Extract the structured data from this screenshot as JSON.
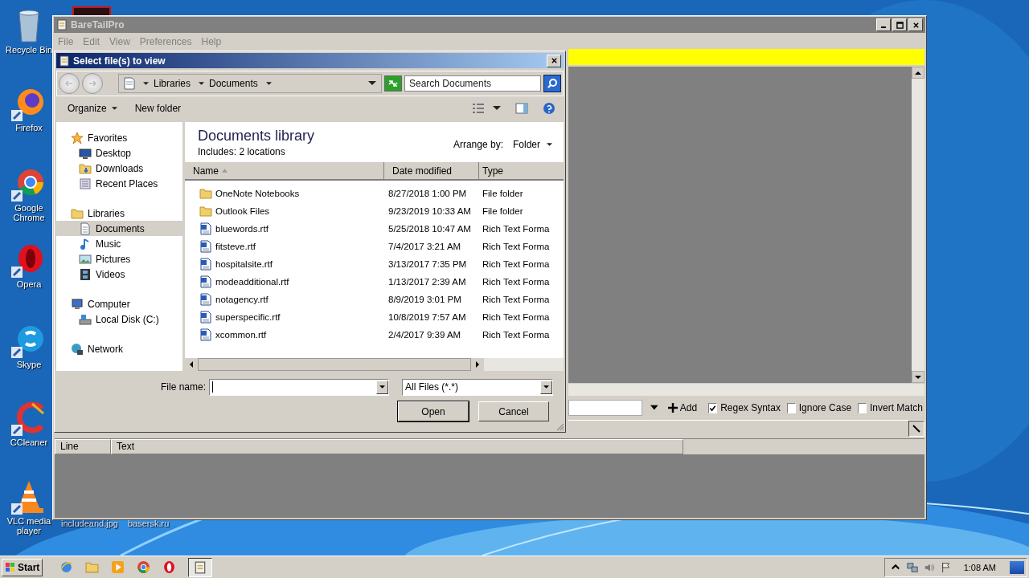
{
  "desktop": {
    "icons": [
      {
        "label": "Recycle Bin"
      },
      {
        "label": "Firefox"
      },
      {
        "label": "Google Chrome"
      },
      {
        "label": "Opera"
      },
      {
        "label": "Skype"
      },
      {
        "label": "CCleaner"
      },
      {
        "label": "VLC media player"
      }
    ],
    "files": [
      {
        "label": "includeand.jpg"
      },
      {
        "label": "basersk.ru"
      }
    ]
  },
  "main_window": {
    "title": "BareTailPro",
    "menu": [
      "File",
      "Edit",
      "View",
      "Preferences",
      "Help"
    ],
    "filter": {
      "add": "Add",
      "options": [
        {
          "label": "Regex Syntax",
          "checked": true
        },
        {
          "label": "Ignore Case",
          "checked": false
        },
        {
          "label": "Invert Match",
          "checked": false
        }
      ]
    },
    "columns": [
      "Line",
      "Text"
    ]
  },
  "dialog": {
    "title": "Select file(s) to view",
    "breadcrumb": [
      "Libraries",
      "Documents"
    ],
    "search": {
      "placeholder": "Search Documents"
    },
    "toolbar": [
      "Organize",
      "New folder"
    ],
    "nav": [
      {
        "label": "Favorites",
        "selected": false,
        "children": [
          {
            "label": "Desktop",
            "selected": false
          },
          {
            "label": "Downloads",
            "selected": false
          },
          {
            "label": "Recent Places",
            "selected": false
          }
        ]
      },
      {
        "label": "Libraries",
        "selected": false,
        "children": [
          {
            "label": "Documents",
            "selected": true
          },
          {
            "label": "Music",
            "selected": false
          },
          {
            "label": "Pictures",
            "selected": false
          },
          {
            "label": "Videos",
            "selected": false
          }
        ]
      },
      {
        "label": "Computer",
        "selected": false,
        "children": [
          {
            "label": "Local Disk (C:)",
            "selected": false
          }
        ]
      },
      {
        "label": "Network",
        "selected": false
      }
    ],
    "library": {
      "title": "Documents library",
      "includes": "Includes:",
      "locations": "2 locations",
      "arrange_label": "Arrange by:",
      "arrange_value": "Folder"
    },
    "columns": [
      "Name",
      "Date modified",
      "Type"
    ],
    "rows": [
      {
        "kind": "folder",
        "name": "OneNote Notebooks",
        "date": "8/27/2018 1:00 PM",
        "type": "File folder"
      },
      {
        "kind": "folder",
        "name": "Outlook Files",
        "date": "9/23/2019 10:33 AM",
        "type": "File folder"
      },
      {
        "kind": "file",
        "name": "bluewords.rtf",
        "date": "5/25/2018 10:47 AM",
        "type": "Rich Text Forma"
      },
      {
        "kind": "file",
        "name": "fitsteve.rtf",
        "date": "7/4/2017 3:21 AM",
        "type": "Rich Text Forma"
      },
      {
        "kind": "file",
        "name": "hospitalsite.rtf",
        "date": "3/13/2017 7:35 PM",
        "type": "Rich Text Forma"
      },
      {
        "kind": "file",
        "name": "modeadditional.rtf",
        "date": "1/13/2017 2:39 AM",
        "type": "Rich Text Forma"
      },
      {
        "kind": "file",
        "name": "notagency.rtf",
        "date": "8/9/2019 3:01 PM",
        "type": "Rich Text Forma"
      },
      {
        "kind": "file",
        "name": "superspecific.rtf",
        "date": "10/8/2019 7:57 AM",
        "type": "Rich Text Forma"
      },
      {
        "kind": "file",
        "name": "xcommon.rtf",
        "date": "2/4/2017 9:39 AM",
        "type": "Rich Text Forma"
      }
    ],
    "file_name_label": "File name:",
    "file_type": "All Files (*.*)",
    "buttons": [
      "Open",
      "Cancel"
    ]
  },
  "taskbar": {
    "start": "Start",
    "clock": "1:08 AM"
  }
}
